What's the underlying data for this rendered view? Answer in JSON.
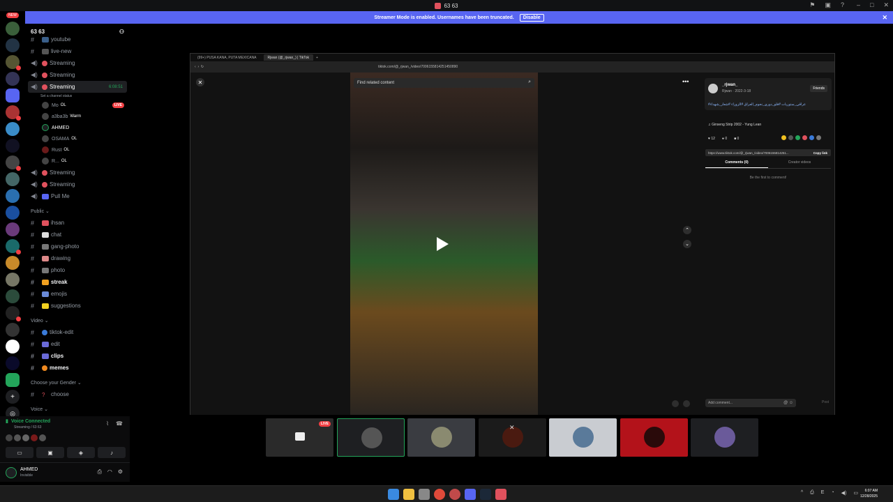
{
  "window": {
    "title": "63 63"
  },
  "banner": {
    "text": "Streamer Mode is enabled. Usernames have been truncated.",
    "button": "Disable"
  },
  "rail": {
    "new_tag": "NEW"
  },
  "guild": {
    "name": "63 63"
  },
  "channels_top": [
    {
      "name": "youtube",
      "type": "text"
    },
    {
      "name": "live-new",
      "type": "text"
    },
    {
      "name": "Streaming",
      "type": "voice"
    },
    {
      "name": "Streaming",
      "type": "voice"
    }
  ],
  "active_channel": {
    "name": "Streaming",
    "timer": "6:08:51",
    "status_hint": "Set a channel status"
  },
  "voice_users": [
    {
      "name": "Mo",
      "tag": "OL",
      "live": "LIVE"
    },
    {
      "name": "a3ba3b",
      "tag": "Warm"
    },
    {
      "name": "AHMED",
      "tag": ""
    },
    {
      "name": "OSAMA",
      "tag": "OL"
    },
    {
      "name": "Rust",
      "tag": "OL"
    },
    {
      "name": "R...",
      "tag": "OL"
    }
  ],
  "channels_mid": [
    {
      "name": "Streaming"
    },
    {
      "name": "Streaming"
    },
    {
      "name": "Pull Me"
    }
  ],
  "cat_public": "Public",
  "public_channels": [
    {
      "name": "ihsan",
      "bold": false
    },
    {
      "name": "chat",
      "bold": false
    },
    {
      "name": "gang-photo",
      "bold": false
    },
    {
      "name": "drawing",
      "bold": false
    },
    {
      "name": "photo",
      "bold": false
    },
    {
      "name": "streak",
      "bold": true
    },
    {
      "name": "emojis",
      "bold": false
    },
    {
      "name": "suggestions",
      "bold": false
    }
  ],
  "cat_video": "Video",
  "video_channels": [
    {
      "name": "tiktok-edit",
      "bold": false
    },
    {
      "name": "edit",
      "bold": false
    },
    {
      "name": "clips",
      "bold": true
    },
    {
      "name": "memes",
      "bold": true
    }
  ],
  "cat_gender": "Choose your Gender",
  "gender_channels": [
    {
      "name": "choose"
    }
  ],
  "cat_voice": "Voice",
  "voice_panel": {
    "status": "Voice Connected",
    "location": "Streaming / 63 63"
  },
  "user_panel": {
    "name": "AHMED",
    "status": "Invisible"
  },
  "browser": {
    "tabs": [
      "(99+) PUSA KANA, PUTA MEXICANA",
      "Rjwan (@_rjwan_) | TikTok"
    ],
    "url": "tiktok.com/@_rjwan_/video/7006155814251450890"
  },
  "tiktok": {
    "search_placeholder": "Find related content",
    "author": "_rjwan_",
    "author_sub": "Rjwan · 2022-3-18",
    "friends": "Friends",
    "description": "#عراقي_ستوريات #فلو_دوري_نجوم_العراق #الزوراء #شعار_شهداء",
    "music": "Ginseng Strip 2002 - Yung Lean",
    "likes": "12",
    "comments": "0",
    "saves": "0",
    "link": "https://www.tiktok.com/@_rjwan_/video/7006155814251...",
    "copy_link": "Copy link",
    "tab_comments": "Comments (0)",
    "tab_creator": "Creator videos",
    "empty_comments": "Be the first to comment!",
    "comment_placeholder": "Add comment...",
    "post": "Post"
  },
  "stream_tiles": [
    {
      "name": "tile-1",
      "live": "LIVE",
      "color": "#2a2a2a"
    },
    {
      "name": "tile-2",
      "color": "#1e1f22"
    },
    {
      "name": "tile-3",
      "color": "#3a3c41"
    },
    {
      "name": "tile-4",
      "color": "#1b1b1b"
    },
    {
      "name": "tile-5",
      "color": "#c9ccd1"
    },
    {
      "name": "tile-6",
      "color": "#b3121a"
    },
    {
      "name": "tile-7",
      "color": "#1e1f22"
    }
  ],
  "taskbar": {
    "time": "6:07 AM",
    "date": "12/28/2025"
  }
}
